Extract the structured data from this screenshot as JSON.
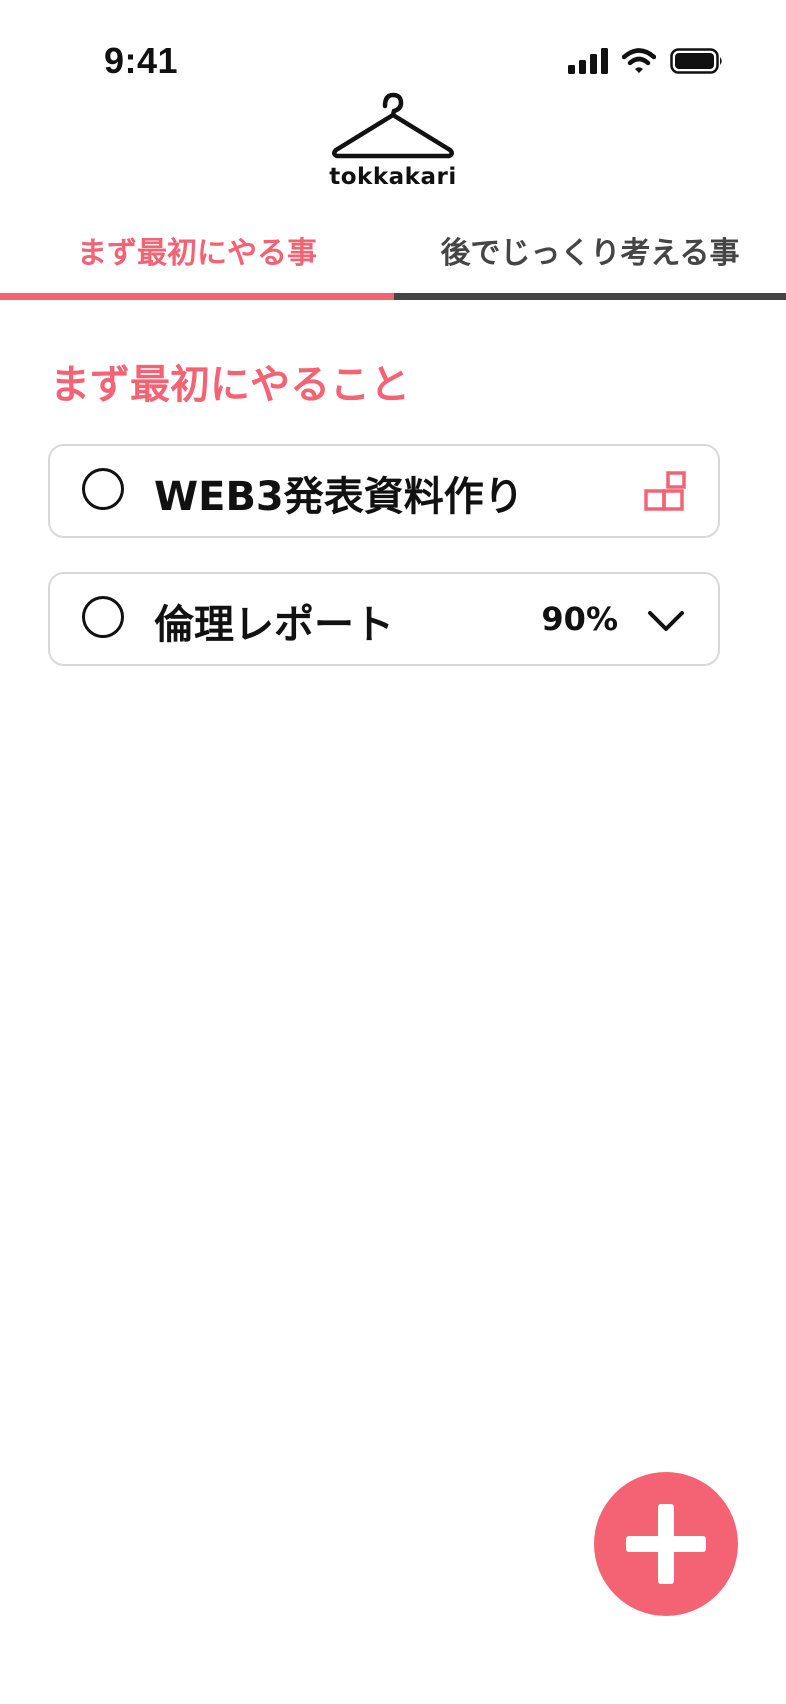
{
  "status_bar": {
    "time": "9:41"
  },
  "app": {
    "logo_text": "tokkakari",
    "logo_icon": "hanger-icon"
  },
  "tabs": [
    {
      "label": "まず最初にやる事",
      "active": true
    },
    {
      "label": "後でじっくり考える事",
      "active": false
    }
  ],
  "main": {
    "section_title": "まず最初にやること",
    "tasks": [
      {
        "title": "WEB3発表資料作り",
        "action_icon": "subtasks-icon"
      },
      {
        "title": "倫理レポート",
        "progress_text": "90%",
        "progress": 0.9,
        "action_icon": "chevron-down-icon"
      }
    ]
  },
  "fab": {
    "icon": "plus-icon"
  },
  "colors": {
    "accent": "#F46373",
    "inactive_tab": "#454545",
    "card_border": "#D8D8D8"
  }
}
